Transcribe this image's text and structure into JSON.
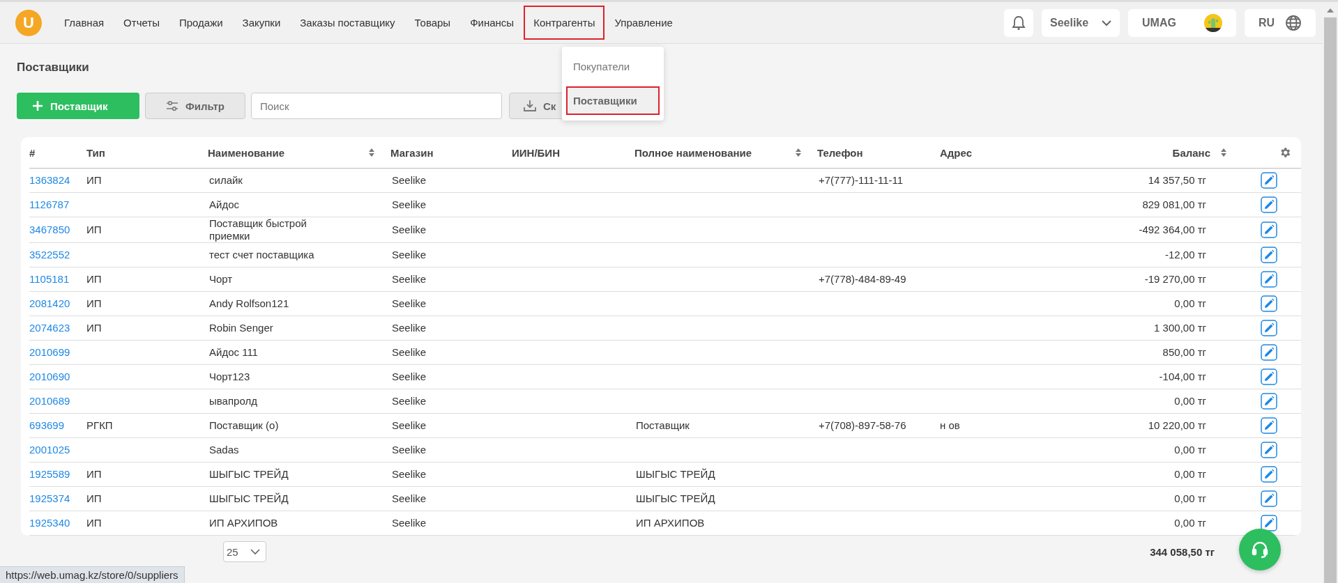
{
  "logo": "U",
  "nav": [
    {
      "label": "Главная",
      "highlighted": false
    },
    {
      "label": "Отчеты",
      "highlighted": false
    },
    {
      "label": "Продажи",
      "highlighted": false
    },
    {
      "label": "Закупки",
      "highlighted": false
    },
    {
      "label": "Заказы поставщику",
      "highlighted": false
    },
    {
      "label": "Товары",
      "highlighted": false
    },
    {
      "label": "Финансы",
      "highlighted": false
    },
    {
      "label": "Контрагенты",
      "highlighted": true
    },
    {
      "label": "Управление",
      "highlighted": false
    }
  ],
  "nav_menu": [
    {
      "label": "Покупатели",
      "selected": false
    },
    {
      "label": "Поставщики",
      "selected": true
    }
  ],
  "store_select": "Seelike",
  "account": "UMAG",
  "language": "RU",
  "page_title": "Поставщики",
  "toolbar": {
    "add_button": "Поставщик",
    "filter_button": "Фильтр",
    "search": {
      "placeholder": "Поиск"
    },
    "export_button": "Ск"
  },
  "table": {
    "columns": [
      {
        "label": "#",
        "sortable": false
      },
      {
        "label": "Тип",
        "sortable": false
      },
      {
        "label": "Наименование",
        "sortable": true
      },
      {
        "label": "Магазин",
        "sortable": false
      },
      {
        "label": "ИИН/БИН",
        "sortable": false
      },
      {
        "label": "Полное наименование",
        "sortable": true
      },
      {
        "label": "Телефон",
        "sortable": false
      },
      {
        "label": "Адрес",
        "sortable": false
      },
      {
        "label": "Баланс",
        "sortable": true
      }
    ],
    "rows": [
      {
        "id": "1363824",
        "type": "ИП",
        "name": "силайк",
        "store": "Seelike",
        "full_name": "",
        "phone": "+7(777)-111-11-11",
        "address": "",
        "balance": "14 357,50 тг"
      },
      {
        "id": "1126787",
        "type": "",
        "name": "Айдос",
        "store": "Seelike",
        "full_name": "",
        "phone": "",
        "address": "",
        "balance": "829 081,00 тг"
      },
      {
        "id": "3467850",
        "type": "ИП",
        "name": "Поставщик быстрой приемки",
        "store": "Seelike",
        "full_name": "",
        "phone": "",
        "address": "",
        "balance": "-492 364,00 тг"
      },
      {
        "id": "3522552",
        "type": "",
        "name": "тест счет поставщика",
        "store": "Seelike",
        "full_name": "",
        "phone": "",
        "address": "",
        "balance": "-12,00 тг"
      },
      {
        "id": "1105181",
        "type": "ИП",
        "name": "Чорт",
        "store": "Seelike",
        "full_name": "",
        "phone": "+7(778)-484-89-49",
        "address": "",
        "balance": "-19 270,00 тг"
      },
      {
        "id": "2081420",
        "type": "ИП",
        "name": "Andy Rolfson121",
        "store": "Seelike",
        "full_name": "",
        "phone": "",
        "address": "",
        "balance": "0,00 тг"
      },
      {
        "id": "2074623",
        "type": "ИП",
        "name": "Robin Senger",
        "store": "Seelike",
        "full_name": "",
        "phone": "",
        "address": "",
        "balance": "1 300,00 тг"
      },
      {
        "id": "2010699",
        "type": "",
        "name": "Айдос 111",
        "store": "Seelike",
        "full_name": "",
        "phone": "",
        "address": "",
        "balance": "850,00 тг"
      },
      {
        "id": "2010690",
        "type": "",
        "name": "Чорт123",
        "store": "Seelike",
        "full_name": "",
        "phone": "",
        "address": "",
        "balance": "-104,00 тг"
      },
      {
        "id": "2010689",
        "type": "",
        "name": "ывапролд",
        "store": "Seelike",
        "full_name": "",
        "phone": "",
        "address": "",
        "balance": "0,00 тг"
      },
      {
        "id": "693699",
        "type": "РГКП",
        "name": "Поставщик (о)",
        "store": "Seelike",
        "full_name": "Поставщик",
        "phone": "+7(708)-897-58-76",
        "address": "н ов",
        "balance": "10 220,00 тг"
      },
      {
        "id": "2001025",
        "type": "",
        "name": "Sadas",
        "store": "Seelike",
        "full_name": "",
        "phone": "",
        "address": "",
        "balance": "0,00 тг"
      },
      {
        "id": "1925589",
        "type": "ИП",
        "name": "ШЫГЫС ТРЕЙД",
        "store": "Seelike",
        "full_name": "ШЫГЫС ТРЕЙД",
        "phone": "",
        "address": "",
        "balance": "0,00 тг"
      },
      {
        "id": "1925374",
        "type": "ИП",
        "name": "ШЫГЫС ТРЕЙД",
        "store": "Seelike",
        "full_name": "ШЫГЫС ТРЕЙД",
        "phone": "",
        "address": "",
        "balance": "0,00 тг"
      },
      {
        "id": "1925340",
        "type": "ИП",
        "name": "ИП АРХИПОВ",
        "store": "Seelike",
        "full_name": "ИП АРХИПОВ",
        "phone": "",
        "address": "",
        "balance": "0,00 тг"
      }
    ]
  },
  "page_size": "25",
  "total": "344 058,50 тг",
  "status_url": "https://web.umag.kz/store/0/suppliers"
}
